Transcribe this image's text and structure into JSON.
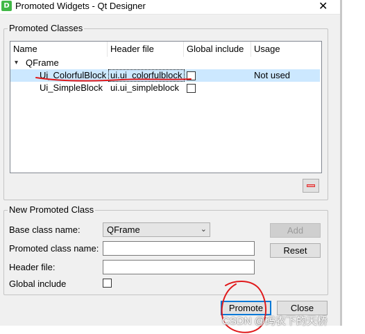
{
  "window": {
    "icon_letter": "D",
    "title": "Promoted Widgets - Qt Designer",
    "close_glyph": "✕"
  },
  "promoted_classes": {
    "group_title": "Promoted Classes",
    "columns": [
      "Name",
      "Header file",
      "Global include",
      "Usage"
    ],
    "base_class": "QFrame",
    "rows": [
      {
        "name": "Ui_ColorfulBlock",
        "header": "ui.ui_colorfulblock",
        "global_include": false,
        "usage": "Not used",
        "selected": true
      },
      {
        "name": "Ui_SimpleBlock",
        "header": "ui.ui_simpleblock",
        "global_include": false,
        "usage": "",
        "selected": false
      }
    ]
  },
  "new_promoted_class": {
    "group_title": "New Promoted Class",
    "base_class_label": "Base class name:",
    "base_class_value": "QFrame",
    "promoted_class_label": "Promoted class name:",
    "promoted_class_value": "",
    "header_file_label": "Header file:",
    "header_file_value": "",
    "global_include_label": "Global include",
    "global_include_checked": false,
    "add_label": "Add",
    "reset_label": "Reset"
  },
  "buttons": {
    "promote_label": "Promote",
    "close_label": "Close"
  },
  "watermark": "CSDN @码农下的天桥",
  "colors": {
    "selection": "#cce8ff",
    "annotation_red": "#e0191b",
    "default_button_border": "#0078d7"
  }
}
